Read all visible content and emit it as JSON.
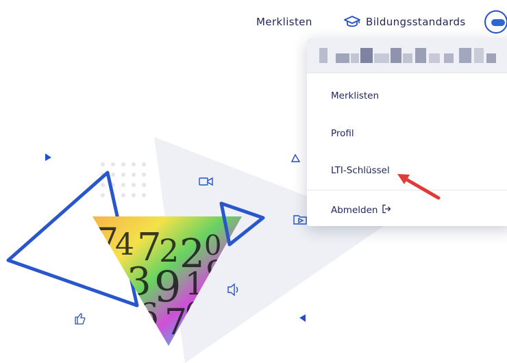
{
  "nav": {
    "merklisten": "Merklisten",
    "bildungsstandards": "Bildungsstandards",
    "bildungsstandards_icon": "graduation-cap-icon",
    "avatar_icon": "user-avatar-icon"
  },
  "dropdown": {
    "items": [
      {
        "label": "Merklisten"
      },
      {
        "label": "Profil"
      },
      {
        "label": "LTI-Schlüssel"
      },
      {
        "label": "Abmelden",
        "icon": "logout-icon"
      }
    ]
  },
  "colors": {
    "text": "#1f2559",
    "accent": "#2250c8",
    "annotation": "#e2393a"
  }
}
